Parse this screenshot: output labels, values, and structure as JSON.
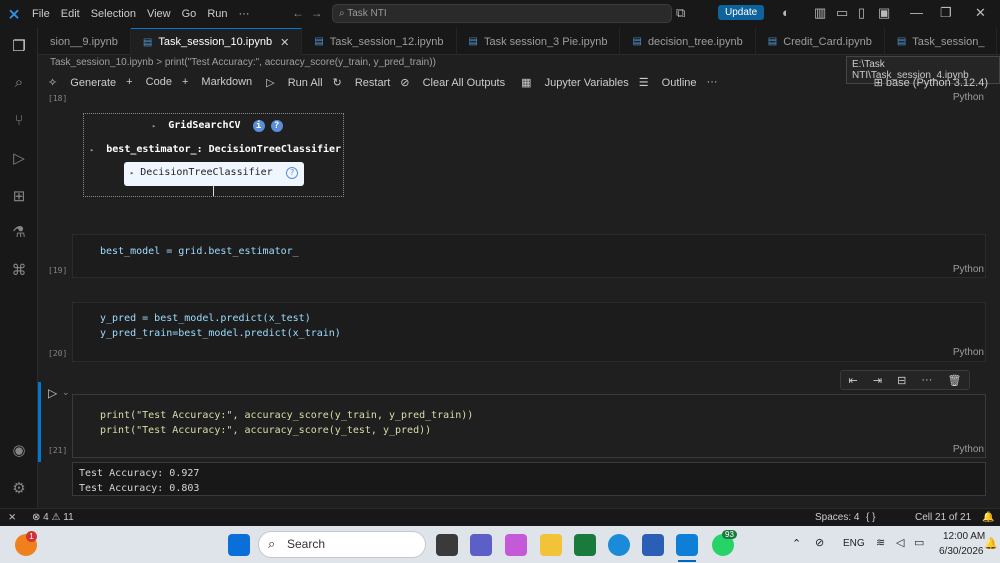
{
  "menu": [
    "File",
    "Edit",
    "Selection",
    "View",
    "Go",
    "Run"
  ],
  "menu_more": "···",
  "command_center": "Task NTI",
  "update_label": "Update",
  "tabs": [
    {
      "label": "sion__9.ipynb",
      "active": false
    },
    {
      "label": "Task_session_10.ipynb",
      "active": true
    },
    {
      "label": "Task_session_12.ipynb",
      "active": false
    },
    {
      "label": "Task session_3 Pie.ipynb",
      "active": false
    },
    {
      "label": "decision_tree.ipynb",
      "active": false
    },
    {
      "label": "Credit_Card.ipynb",
      "active": false
    },
    {
      "label": "Task_session_",
      "active": false
    }
  ],
  "tab_close": "✕",
  "tooltip": "E:\\Task NTI\\Task_session_4.ipynb",
  "breadcrumb": {
    "file": "Task_session_10.ipynb",
    "sep": ">",
    "cell": "print(\"Test Accuracy:\", accuracy_score(y_train, y_pred_train))"
  },
  "toolbar": {
    "generate": "Generate",
    "code": "Code",
    "markdown": "Markdown",
    "run_all": "Run All",
    "restart": "Restart",
    "clear": "Clear All Outputs",
    "variables": "Jupyter Variables",
    "outline": "Outline",
    "more": "···"
  },
  "kernel": "base (Python 3.12.4)",
  "cells": {
    "c18": {
      "num": "[18]",
      "lang": "Python"
    },
    "widget": {
      "title": "GridSearchCV",
      "estimator": "best_estimator_: DecisionTreeClassifier",
      "inner": "DecisionTreeClassifier",
      "info": "i",
      "help": "?"
    },
    "c19": {
      "num": "[19]",
      "lang": "Python",
      "line1": "best_model = grid.best_estimator_"
    },
    "c20": {
      "num": "[20]",
      "lang": "Python",
      "line1": "y_pred = best_model.predict(x_test)",
      "line2": "y_pred_train=best_model.predict(x_train)"
    },
    "c21": {
      "num": "[21]",
      "lang": "Python",
      "line1": "print(\"Test Accuracy:\", accuracy_score(y_train, y_pred_train))",
      "line2": "print(\"Test Accuracy:\", accuracy_score(y_test, y_pred))"
    },
    "output": {
      "line1": "Test Accuracy: 0.927",
      "line2": "Test Accuracy: 0.803"
    }
  },
  "status": {
    "errors": "4",
    "warnings": "11",
    "spaces": "Spaces: 4",
    "braces": "{ }",
    "cell": "Cell 21 of 21"
  },
  "taskbar": {
    "search": "Search",
    "lang": "ENG",
    "time": "12:00 AM",
    "date": "6/30/2026",
    "whatsapp_badge": "93",
    "weather_badge": "1"
  }
}
